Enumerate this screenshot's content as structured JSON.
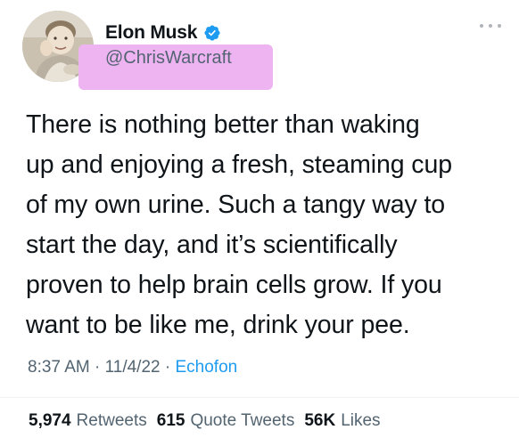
{
  "colors": {
    "highlight": "#eeb4f2",
    "verified_blue": "#1d9bf0",
    "link_blue": "#1d9bf0",
    "secondary_text": "#536471",
    "primary_text": "#0f1419"
  },
  "author": {
    "display_name": "Elon Musk",
    "handle": "@ChrisWarcraft",
    "verified_icon": "verified-badge-icon",
    "avatar": "child-photo-avatar"
  },
  "more_icon": "more-horizontal-icon",
  "tweet": {
    "text": "There is nothing better than waking\nup and enjoying a fresh, steaming cup\nof my own urine. Such a tangy way to\nstart the day, and it’s scientifically\nproven to help brain cells grow. If you\nwant to be like me, drink your pee."
  },
  "meta": {
    "time": "8:37 AM",
    "separator1": " · ",
    "date": "11/4/22",
    "separator2": " · ",
    "source": "Echofon"
  },
  "stats": [
    {
      "count": "5,974",
      "label": "Retweets"
    },
    {
      "count": "615",
      "label": "Quote Tweets"
    },
    {
      "count": "56K",
      "label": "Likes"
    }
  ]
}
